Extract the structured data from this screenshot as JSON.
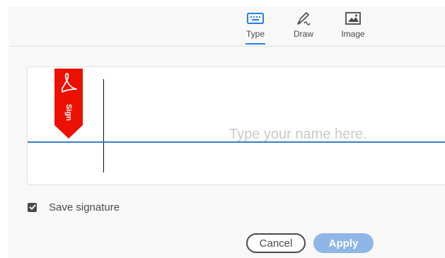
{
  "tabs": [
    {
      "label": "Type",
      "icon": "keyboard-icon",
      "active": true
    },
    {
      "label": "Draw",
      "icon": "pen-draw-icon",
      "active": false
    },
    {
      "label": "Image",
      "icon": "image-icon",
      "active": false
    }
  ],
  "signature_area": {
    "flag_label": "Sign",
    "flag_icon": "acrobat-logo-icon",
    "input_placeholder": "Type your name here.",
    "input_value": ""
  },
  "save_signature": {
    "label": "Save signature",
    "checked": true
  },
  "buttons": {
    "cancel_label": "Cancel",
    "apply_label": "Apply"
  },
  "colors": {
    "accent": "#2680eb",
    "flag_red": "#eb1000",
    "apply_disabled": "#8fb6e6",
    "baseline": "#3d7cc7"
  }
}
